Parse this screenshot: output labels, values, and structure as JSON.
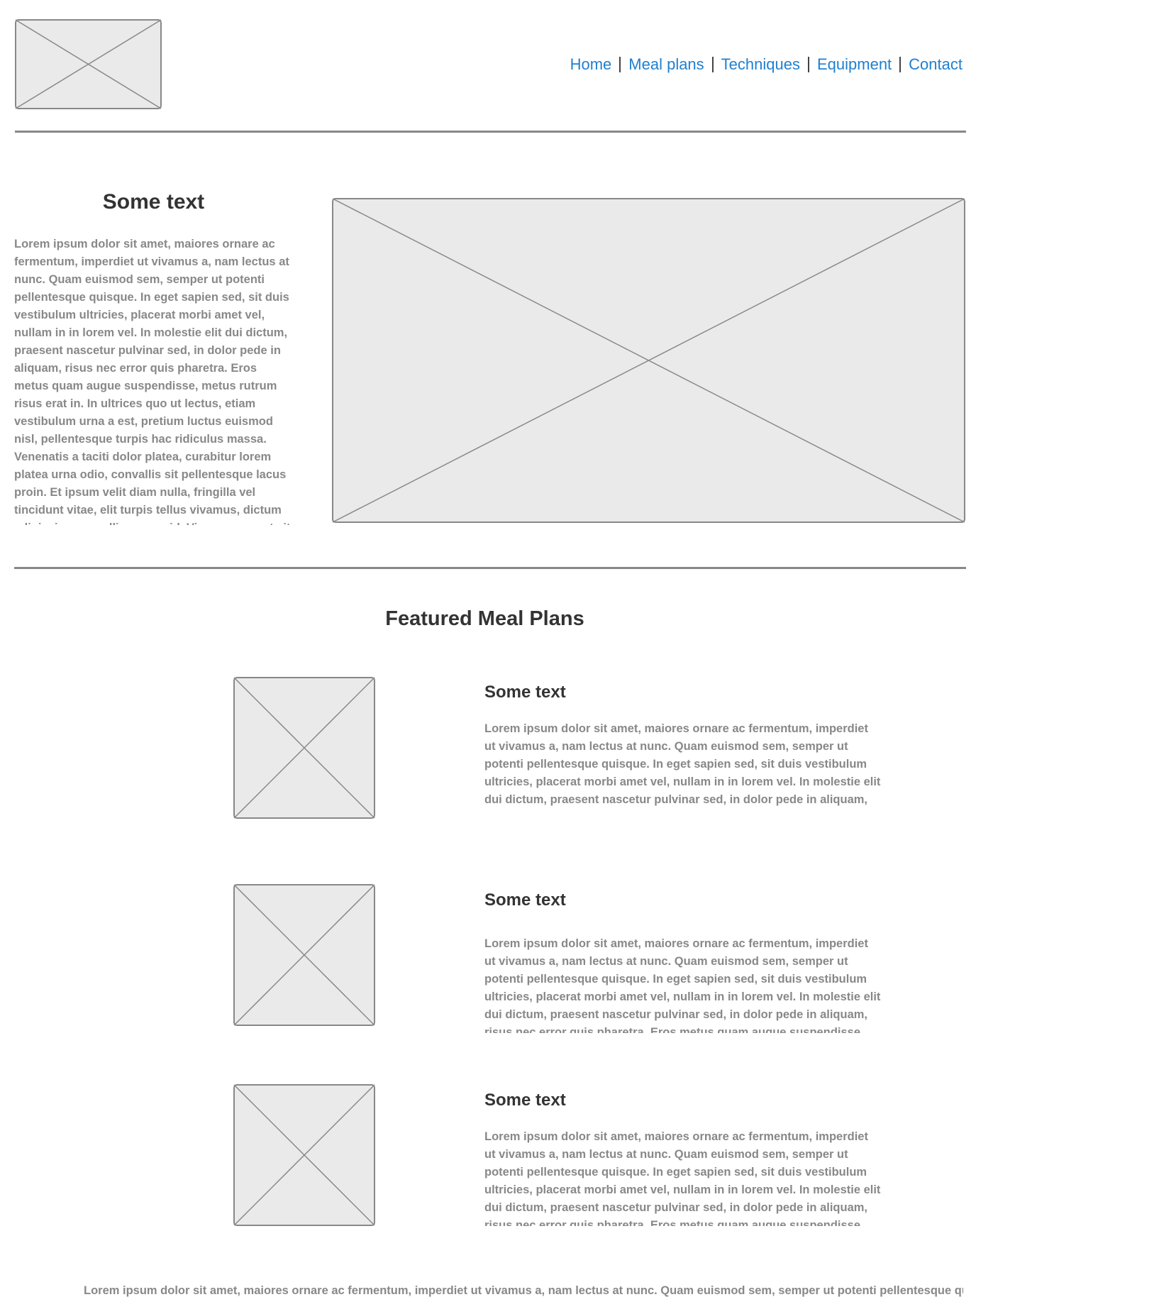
{
  "header": {
    "logo_icon": "image-placeholder-icon",
    "nav": {
      "items": [
        "Home",
        "Meal plans",
        "Techniques",
        "Equipment",
        "Contact"
      ],
      "color": "#1f80d0"
    }
  },
  "hero": {
    "title": "Some text",
    "body": "Lorem ipsum dolor sit amet, maiores ornare ac fermentum, imperdiet ut vivamus a, nam lectus at nunc. Quam euismod sem, semper ut potenti pellentesque quisque. In eget sapien sed, sit duis vestibulum ultricies, placerat morbi amet vel, nullam in in lorem vel. In molestie elit dui dictum, praesent nascetur pulvinar sed, in dolor pede in aliquam, risus nec error quis pharetra. Eros metus quam augue suspendisse, metus rutrum risus erat in.  In ultrices quo ut lectus, etiam vestibulum urna a est, pretium luctus euismod nisl, pellentesque turpis hac ridiculus massa. Venenatis a taciti dolor platea, curabitur lorem platea urna odio, convallis sit pellentesque lacus proin. Et ipsum velit diam nulla, fringilla vel tincidunt vitae, elit turpis tellus vivamus, dictum adipiscing convallis magna id. Viverra eu amet sit,",
    "image_icon": "image-placeholder-icon"
  },
  "featured": {
    "title": "Featured Meal Plans",
    "items": [
      {
        "title": "Some text",
        "body": "Lorem ipsum dolor sit amet, maiores ornare ac fermentum, imperdiet ut vivamus a, nam lectus at nunc. Quam euismod sem, semper ut potenti pellentesque quisque. In eget sapien sed, sit duis vestibulum ultricies, placerat morbi amet vel, nullam in in lorem vel. In molestie elit dui dictum, praesent nascetur pulvinar sed, in dolor pede in aliquam, risus nec error quis pharetra. Eros metus quam augue suspendisse, metus rutrum risus erat in."
      },
      {
        "title": "Some text",
        "body": "Lorem ipsum dolor sit amet, maiores ornare ac fermentum, imperdiet ut vivamus a, nam lectus at nunc. Quam euismod sem, semper ut potenti pellentesque quisque. In eget sapien sed, sit duis vestibulum ultricies, placerat morbi amet vel, nullam in in lorem vel. In molestie elit dui dictum, praesent nascetur pulvinar sed, in dolor pede in aliquam, risus nec error quis pharetra. Eros metus quam augue suspendisse, metus rutrum risus erat in."
      },
      {
        "title": "Some text",
        "body": "Lorem ipsum dolor sit amet, maiores ornare ac fermentum, imperdiet ut vivamus a, nam lectus at nunc. Quam euismod sem, semper ut potenti pellentesque quisque. In eget sapien sed, sit duis vestibulum ultricies, placerat morbi amet vel, nullam in in lorem vel. In molestie elit dui dictum, praesent nascetur pulvinar sed, in dolor pede in aliquam, risus nec error quis pharetra. Eros metus quam augue suspendisse, metus rutrum risus erat in."
      }
    ]
  },
  "footer": {
    "text": "Lorem ipsum dolor sit amet, maiores ornare ac fermentum, imperdiet ut vivamus a, nam lectus at nunc. Quam euismod sem, semper ut potenti pellentesque quisque. In"
  }
}
